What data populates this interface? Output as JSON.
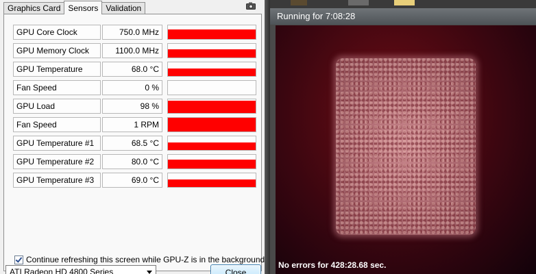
{
  "gpuz": {
    "tabs": [
      {
        "label": "Graphics Card",
        "active": false
      },
      {
        "label": "Sensors",
        "active": true
      },
      {
        "label": "Validation",
        "active": false
      }
    ],
    "sensors": [
      {
        "label": "GPU Core Clock",
        "value": "750.0 MHz",
        "level": 0.7
      },
      {
        "label": "GPU Memory Clock",
        "value": "1100.0 MHz",
        "level": 0.6
      },
      {
        "label": "GPU Temperature",
        "value": "68.0 °C",
        "level": 0.55
      },
      {
        "label": "Fan Speed",
        "value": "0 %",
        "level": 0.0
      },
      {
        "label": "GPU Load",
        "value": "98 %",
        "level": 0.9
      },
      {
        "label": "Fan Speed",
        "value": "1 RPM",
        "level": 1.0
      },
      {
        "label": "GPU Temperature #1",
        "value": "68.5 °C",
        "level": 0.55
      },
      {
        "label": "GPU Temperature #2",
        "value": "80.0 °C",
        "level": 0.65
      },
      {
        "label": "GPU Temperature #3",
        "value": "69.0 °C",
        "level": 0.55
      }
    ],
    "refresh_label": "Continue refreshing this screen while GPU-Z is in the background",
    "refresh_checked": true,
    "gpu_selected": "ATI Radeon HD 4800 Series",
    "close_label": "Close",
    "bar_color": "#ff0000"
  },
  "furmark": {
    "title": "Running for 7:08:28",
    "status": "No errors for 428:28.68 sec."
  }
}
